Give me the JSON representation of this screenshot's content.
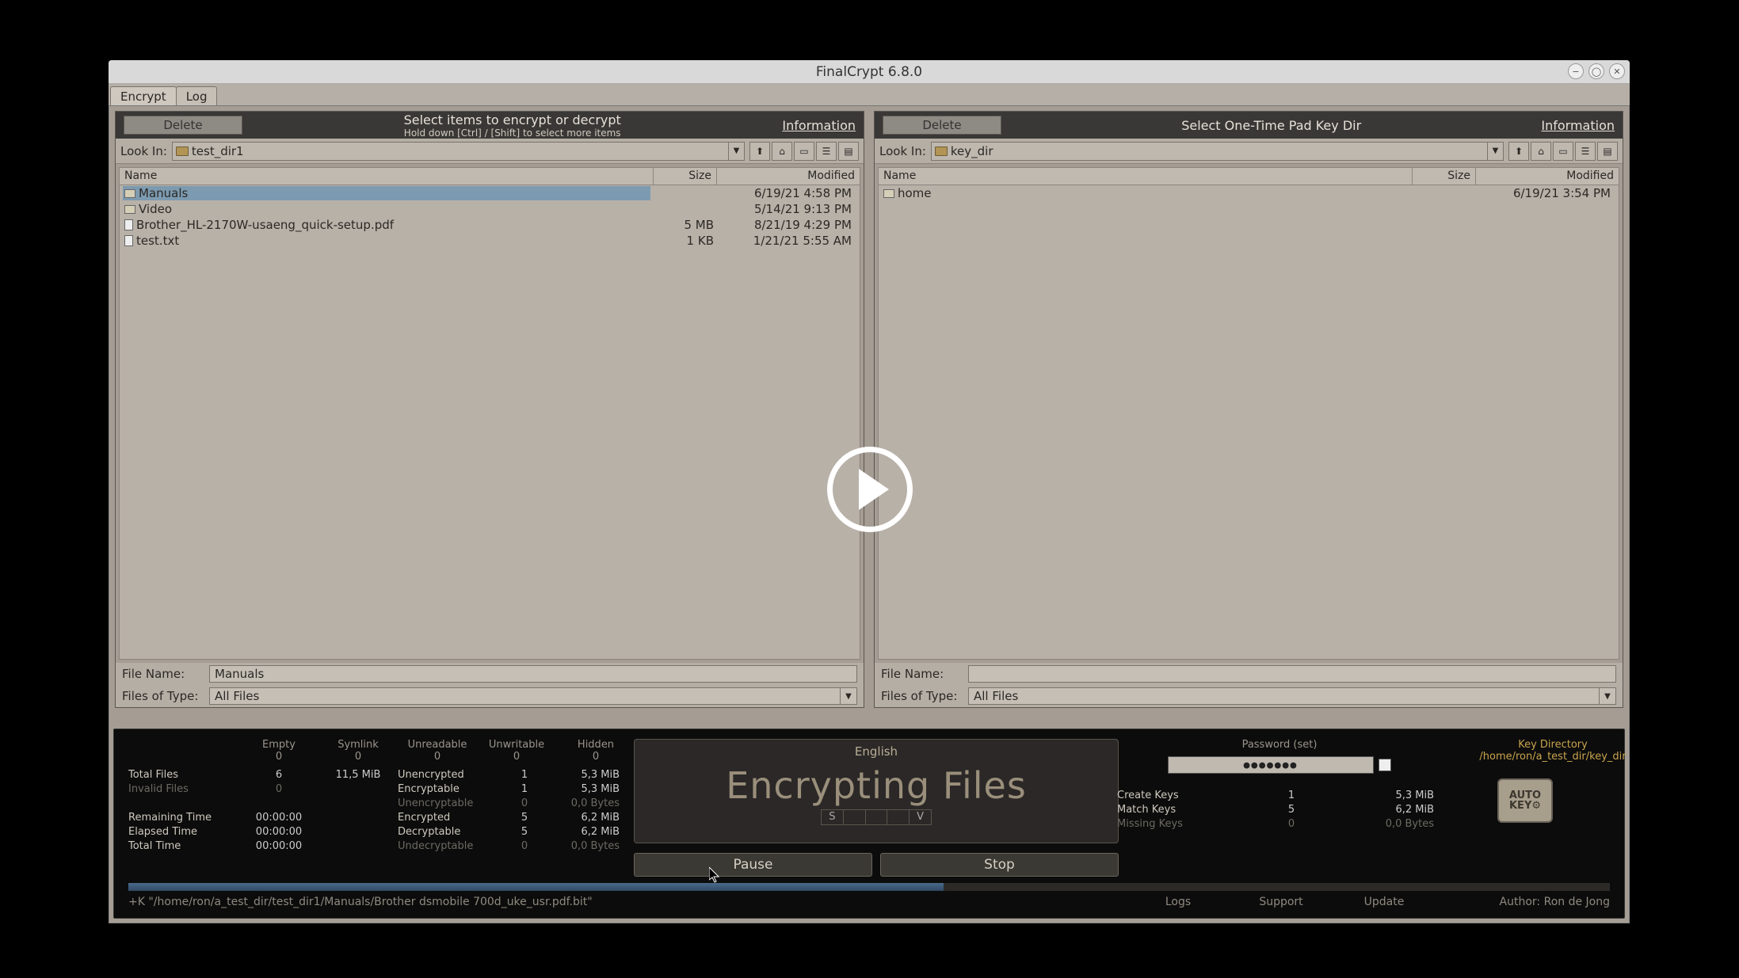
{
  "window": {
    "title": "FinalCrypt 6.8.0"
  },
  "tabs": [
    "Encrypt",
    "Log"
  ],
  "panels": {
    "left": {
      "delete": "Delete",
      "title": "Select items to encrypt or decrypt",
      "hint": "Hold down [Ctrl] / [Shift] to select more items",
      "info": "Information",
      "lookin_label": "Look In:",
      "lookin_value": "test_dir1",
      "cols": {
        "name": "Name",
        "size": "Size",
        "modified": "Modified"
      },
      "files": [
        {
          "icon": "folder",
          "name": "Manuals",
          "size": "",
          "modified": "6/19/21 4:58 PM",
          "selected": true
        },
        {
          "icon": "folder",
          "name": "Video",
          "size": "",
          "modified": "5/14/21 9:13 PM",
          "selected": false
        },
        {
          "icon": "doc",
          "name": "Brother_HL-2170W-usaeng_quick-setup.pdf",
          "size": "5 MB",
          "modified": "8/21/19 4:29 PM",
          "selected": false
        },
        {
          "icon": "doc",
          "name": "test.txt",
          "size": "1 KB",
          "modified": "1/21/21 5:55 AM",
          "selected": false
        }
      ],
      "filename_label": "File Name:",
      "filename_value": "Manuals",
      "filter_label": "Files of Type:",
      "filter_value": "All Files"
    },
    "right": {
      "delete": "Delete",
      "title": "Select One-Time Pad Key Dir",
      "info": "Information",
      "lookin_label": "Look In:",
      "lookin_value": "key_dir",
      "cols": {
        "name": "Name",
        "size": "Size",
        "modified": "Modified"
      },
      "files": [
        {
          "icon": "folder",
          "name": "home",
          "size": "",
          "modified": "6/19/21 3:54 PM",
          "selected": false
        }
      ],
      "filename_label": "File Name:",
      "filename_value": "",
      "filter_label": "Files of Type:",
      "filter_value": "All Files"
    }
  },
  "stats": {
    "header": [
      "",
      "Empty",
      "Symlink",
      "Unreadable",
      "Unwritable",
      "Hidden"
    ],
    "header_counts": [
      "",
      "0",
      "0",
      "0",
      "0",
      "0"
    ],
    "rows": [
      {
        "label": "Total Files",
        "v1": "6",
        "v2": "11,5 MiB",
        "label2": "Unencrypted",
        "v3": "1",
        "v4": "5,3 MiB",
        "dim2": false
      },
      {
        "label": "Invalid Files",
        "v1": "0",
        "v2": "",
        "label2": "Encryptable",
        "v3": "1",
        "v4": "5,3 MiB",
        "dim": true
      },
      {
        "label": "",
        "v1": "",
        "v2": "",
        "label2": "Unencryptable",
        "v3": "0",
        "v4": "0,0 Bytes",
        "dim2": true
      },
      {
        "label": "Remaining Time",
        "v1": "00:00:00",
        "v2": "",
        "label2": "Encrypted",
        "v3": "5",
        "v4": "6,2 MiB",
        "time": true
      },
      {
        "label": "Elapsed Time",
        "v1": "00:00:00",
        "v2": "",
        "label2": "Decryptable",
        "v3": "5",
        "v4": "6,2 MiB",
        "time": true
      },
      {
        "label": "Total Time",
        "v1": "00:00:00",
        "v2": "",
        "label2": "Undecryptable",
        "v3": "0",
        "v4": "0,0 Bytes",
        "time": true,
        "dim2": true
      }
    ]
  },
  "center": {
    "language": "English",
    "headline": "Encrypting Files",
    "segments": [
      "S",
      "",
      "",
      "",
      "V"
    ],
    "pause": "Pause",
    "stop": "Stop"
  },
  "password": {
    "header": "Password (set)",
    "masked": "●●●●●●●",
    "create_keys": {
      "label": "Create Keys",
      "count": "1",
      "size": "5,3 MiB"
    },
    "match_keys": {
      "label": "Match Keys",
      "count": "5",
      "size": "6,2 MiB"
    },
    "missing_keys": {
      "label": "Missing Keys",
      "count": "0",
      "size": "0,0 Bytes"
    }
  },
  "keydir": {
    "label": "Key Directory",
    "path": "/home/ron/a_test_dir/key_dir"
  },
  "autokey": {
    "line1": "AUTO",
    "line2": "KEY⚙"
  },
  "progress_pct": 55,
  "footer": {
    "msg": "+K \"/home/ron/a_test_dir/test_dir1/Manuals/Brother dsmobile 700d_uke_usr.pdf.bit\"",
    "links": [
      "Logs",
      "Support",
      "Update"
    ],
    "author": "Author: Ron de Jong"
  }
}
